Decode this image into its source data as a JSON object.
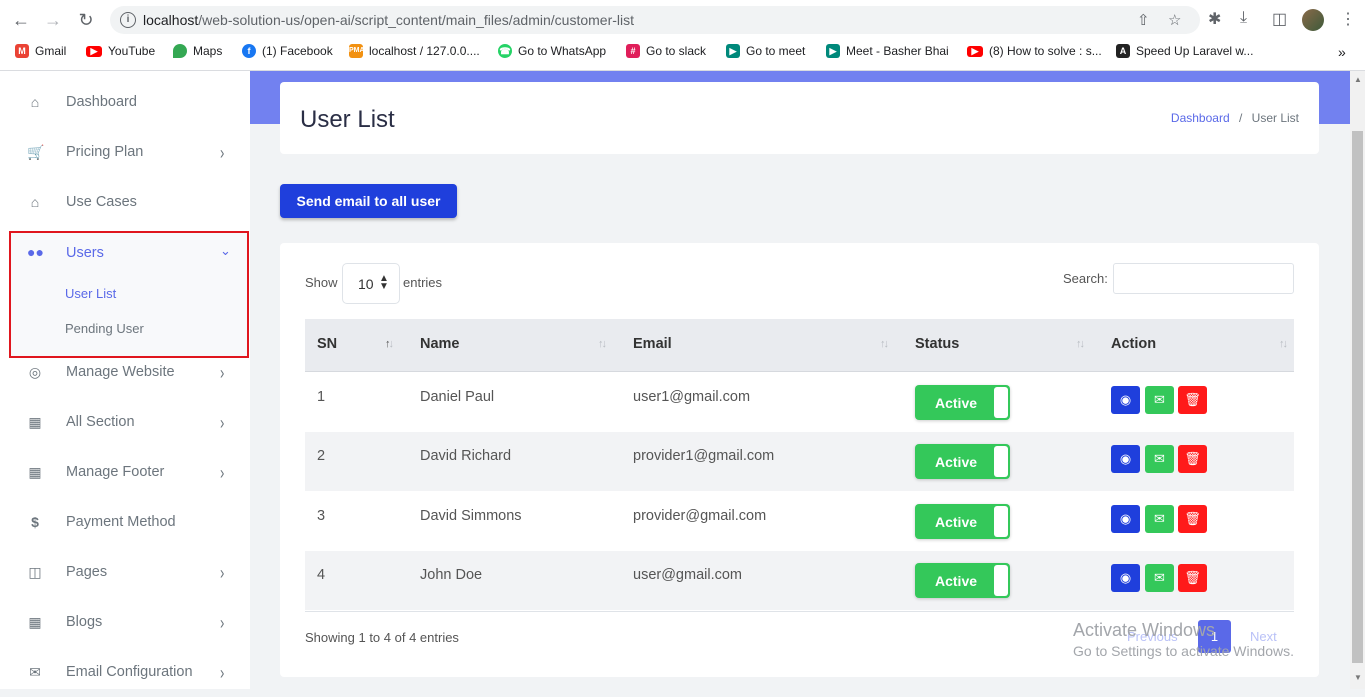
{
  "browser": {
    "url_host": "localhost",
    "url_path": "/web-solution-us/open-ai/script_content/main_files/admin/customer-list",
    "more_bookmarks": "»",
    "bookmarks": [
      {
        "label": "Gmail",
        "icon": "gmail-icon",
        "color": "#ea4335"
      },
      {
        "label": "YouTube",
        "icon": "youtube-icon",
        "color": "#ff0000"
      },
      {
        "label": "Maps",
        "icon": "maps-icon",
        "color": "#34a853"
      },
      {
        "label": "(1) Facebook",
        "icon": "facebook-icon",
        "color": "#1877f2"
      },
      {
        "label": "localhost / 127.0.0....",
        "icon": "phpmyadmin-icon",
        "color": "#f29111"
      },
      {
        "label": "Go to WhatsApp",
        "icon": "whatsapp-icon",
        "color": "#25d366"
      },
      {
        "label": "Go to slack",
        "icon": "slack-icon",
        "color": "#e01e5a"
      },
      {
        "label": "Go to meet",
        "icon": "meet-icon",
        "color": "#00897b"
      },
      {
        "label": "Meet - Basher Bhai",
        "icon": "meet-icon",
        "color": "#00897b"
      },
      {
        "label": "(8) How to solve : s...",
        "icon": "youtube-icon",
        "color": "#ff0000"
      },
      {
        "label": "Speed Up Laravel w...",
        "icon": "laravel-icon",
        "color": "#222222"
      }
    ]
  },
  "sidebar": {
    "items": [
      {
        "label": "Dashboard",
        "icon": "home-icon",
        "chevron": false
      },
      {
        "label": "Pricing Plan",
        "icon": "cart-icon",
        "chevron": true
      },
      {
        "label": "Use Cases",
        "icon": "home-icon",
        "chevron": false
      },
      {
        "label": "Manage Website",
        "icon": "globe-icon",
        "chevron": true
      },
      {
        "label": "All Section",
        "icon": "grid-icon",
        "chevron": true
      },
      {
        "label": "Manage Footer",
        "icon": "grid-icon",
        "chevron": true
      },
      {
        "label": "Payment Method",
        "icon": "dollar-icon",
        "chevron": false
      },
      {
        "label": "Pages",
        "icon": "columns-icon",
        "chevron": true
      },
      {
        "label": "Blogs",
        "icon": "grid-icon",
        "chevron": true
      },
      {
        "label": "Email Configuration",
        "icon": "envelope-icon",
        "chevron": true
      }
    ],
    "users": {
      "label": "Users",
      "icon": "users-icon",
      "sub_items": [
        "User List",
        "Pending User"
      ],
      "active_sub": "User List"
    }
  },
  "header": {
    "title": "User List",
    "breadcrumb_link": "Dashboard",
    "breadcrumb_sep": "/",
    "breadcrumb_current": "User List"
  },
  "actions": {
    "send_email_label": "Send email to all user"
  },
  "table": {
    "show_label": "Show",
    "page_length": "10",
    "entries_label": "entries",
    "search_label": "Search:",
    "search_value": "",
    "columns": [
      "SN",
      "Name",
      "Email",
      "Status",
      "Action"
    ],
    "rows": [
      {
        "sn": "1",
        "name": "Daniel Paul",
        "email": "user1@gmail.com",
        "status": "Active"
      },
      {
        "sn": "2",
        "name": "David Richard",
        "email": "provider1@gmail.com",
        "status": "Active"
      },
      {
        "sn": "3",
        "name": "David Simmons",
        "email": "provider@gmail.com",
        "status": "Active"
      },
      {
        "sn": "4",
        "name": "John Doe",
        "email": "user@gmail.com",
        "status": "Active"
      }
    ],
    "info": "Showing 1 to 4 of 4 entries",
    "pagination": {
      "previous": "Previous",
      "current": "1",
      "next": "Next"
    }
  },
  "watermark": {
    "line1": "Activate Windows",
    "line2": "Go to Settings to activate Windows."
  },
  "colors": {
    "accent": "#5a69e8",
    "primary_button": "#1f3fdc",
    "success": "#34c85a",
    "danger": "#ff1a1a",
    "highlight_border": "#e0161e"
  }
}
